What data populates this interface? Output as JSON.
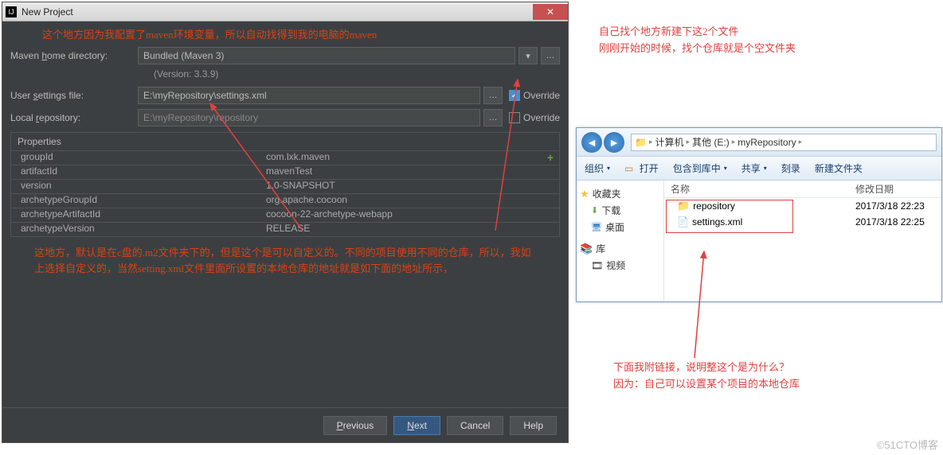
{
  "dialog": {
    "title": "New Project",
    "note_top": "这个地方因为我配置了maven环境变量，所以自动找得到我的电脑的maven",
    "labels": {
      "maven_home": "Maven home directory:",
      "version": "(Version: 3.3.9)",
      "user_settings": "User settings file:",
      "local_repo": "Local repository:",
      "override": "Override",
      "properties": "Properties"
    },
    "values": {
      "maven_home": "Bundled (Maven 3)",
      "user_settings": "E:\\myRepository\\settings.xml",
      "local_repo": "E:\\myRepository\\repository"
    },
    "properties": [
      {
        "k": "groupId",
        "v": "com.lxk.maven"
      },
      {
        "k": "artifactId",
        "v": "mavenTest"
      },
      {
        "k": "version",
        "v": "1.0-SNAPSHOT"
      },
      {
        "k": "archetypeGroupId",
        "v": "org.apache.cocoon"
      },
      {
        "k": "archetypeArtifactId",
        "v": "cocoon-22-archetype-webapp"
      },
      {
        "k": "archetypeVersion",
        "v": "RELEASE"
      }
    ],
    "note_mid": "这地方，默认是在c盘的.m2文件夹下的，但是这个是可以自定义的。不同的项目使用不同的仓库，所以，我如上选择自定义的，当然setting.xml文件里面所设置的本地仓库的地址就是如下面的地址所示，",
    "buttons": {
      "previous": "Previous",
      "next": "Next",
      "cancel": "Cancel",
      "help": "Help"
    }
  },
  "annotations": {
    "top_right": "自己找个地方新建下这2个文件\n刚刚开始的时候，找个仓库就是个空文件夹",
    "bottom_right": "下面我附链接，说明整这个是为什么？\n因为：自己可以设置某个项目的本地仓库"
  },
  "explorer": {
    "crumbs": [
      "计算机",
      "其他 (E:)",
      "myRepository"
    ],
    "toolbar": {
      "organize": "组织",
      "open": "打开",
      "include": "包含到库中",
      "share": "共享",
      "burn": "刻录",
      "newfolder": "新建文件夹"
    },
    "sidebar": {
      "favorites": "收藏夹",
      "downloads": "下载",
      "desktop": "桌面",
      "libraries": "库",
      "videos": "视频"
    },
    "columns": {
      "name": "名称",
      "date": "修改日期"
    },
    "items": [
      {
        "name": "repository",
        "date": "2017/3/18 22:23",
        "type": "folder"
      },
      {
        "name": "settings.xml",
        "date": "2017/3/18 22:25",
        "type": "file"
      }
    ]
  },
  "watermark": "©51CTO博客"
}
